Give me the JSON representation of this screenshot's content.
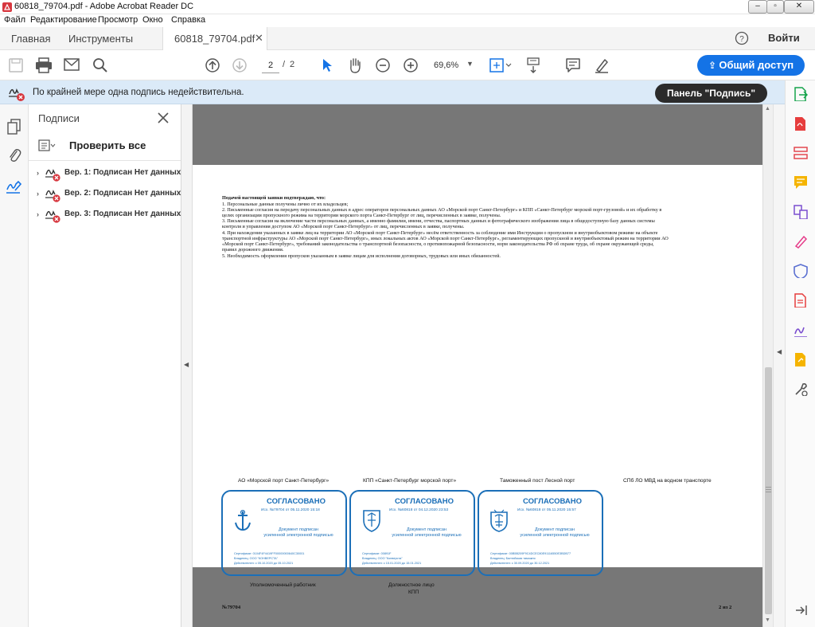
{
  "window": {
    "title": "60818_79704.pdf - Adobe Acrobat Reader DC"
  },
  "menu": [
    "Файл",
    "Редактирование",
    "Просмотр",
    "Окно",
    "Справка"
  ],
  "tabs": {
    "home": "Главная",
    "tools": "Инструменты",
    "document": "60818_79704.pdf",
    "signin": "Войти"
  },
  "toolbar": {
    "page_current": "2",
    "page_sep": "/",
    "page_total": "2",
    "zoom": "69,6%",
    "share": "Общий доступ"
  },
  "notice": {
    "message": "По крайней мере одна подпись недействительна.",
    "panel_button": "Панель \"Подпись\""
  },
  "signatures": {
    "title": "Подписи",
    "verify_all": "Проверить все",
    "items": [
      {
        "label": "Вер. 1: Подписан Нет данных"
      },
      {
        "label": "Вер. 2: Подписан Нет данных"
      },
      {
        "label": "Вер. 3: Подписан Нет данных"
      }
    ]
  },
  "pdf": {
    "heading": "Подачей настоящей заявки подтверждаю, что:",
    "lines": [
      "1. Персональные данные получены лично от их владельцев;",
      "2. Письменные согласия на передачу персональных данных в адрес операторов персональных данных АО «Морской порт Санкт-Петербург» и КПП «Санкт-Петербург морской порт-грузовой» и их обработку в",
      "целях организации пропускного режима на территории морского порта Санкт-Петербург от лиц, перечисленных в заявке, получены.",
      "3. Письменные согласия на включение части персональных данных, а именно фамилии, имени, отчества, паспортных данных и фотографического изображения лица в общедоступную базу данных системы",
      "контроля и управления доступом АО «Морской порт Санкт-Петербург» от лиц, перечисленных в заявке, получены.",
      "4. При нахождении указанных в заявке лиц на территории АО «Морской порт Санкт-Петербург» несём ответственность за соблюдение ими Инструкции о пропускном и внутриобъектовом режиме на объекте",
      "транспортной инфраструктуры АО «Морской порт Санкт-Петербург», иных локальных актов АО «Морской порт Санкт-Петербург», регламентирующих пропускной и внутриобъектовый режим на территории АО",
      "«Морской порт Санкт-Петербург», требований законодательства о транспортной безопасности, о противопожарной безопасности, норм законодательства РФ об охране труда, об охране окружающей среды,",
      "правил дорожного движения.",
      "5. Необходимость оформления пропусков указанным в заявке лицам для исполнения договорных, трудовых или иных обязанностей."
    ],
    "columns": [
      "АО «Морской порт Санкт-Петербург»",
      "КПП «Санкт-Петербург морской порт»",
      "Таможенный пост Лесной порт",
      "СПб ЛО МВД на водном транспорте"
    ],
    "stamps": [
      {
        "title": "СОГЛАСОВАНО",
        "ref": "Исх. №79704 от 05.11.2020 15:18",
        "doc1": "Документ подписан",
        "doc2": "усиленной электронной подписью",
        "cert": "Сертификат: 0104F4F4419FF00000000640C30001",
        "owner": "Владелец: ООО \"КОНВЕРСТА\"",
        "valid": "Действителен: с 05.10.2020 до 05.10.2021"
      },
      {
        "title": "СОГЛАСОВАНО",
        "ref": "Исх. №60818 от 04.12.2020 23:53",
        "doc1": "Документ подписан",
        "doc2": "усиленной электронной подписью",
        "cert": "Сертификат: 00891F",
        "owner": "Владелец: ООО \"Конверста\"",
        "valid": "Действителен: с 15.01.2020 до 15.01.2021"
      },
      {
        "title": "СОГЛАСОВАНО",
        "ref": "Исх. №60818 от 05.11.2020 15:57",
        "doc1": "Документ подписан",
        "doc2": "усиленной электронной подписью",
        "cert": "Сертификат: 00B5B209F9C4DCEC80E91116550E3BDB77",
        "owner": "Владелец: Балтийская таможня",
        "valid": "Действителен: с 30.09.2020 до 30.12.2021"
      }
    ],
    "below": {
      "authorized": "Уполномоченный работник",
      "official1": "Должностное лицо",
      "official2": "КПП"
    },
    "footer_number": "№79704",
    "footer_page": "2 из 2"
  },
  "colors": {
    "accent": "#1473e6",
    "stamp": "#1b6fb8",
    "error": "#d7373f",
    "notice_bg": "#dbeaf8"
  }
}
